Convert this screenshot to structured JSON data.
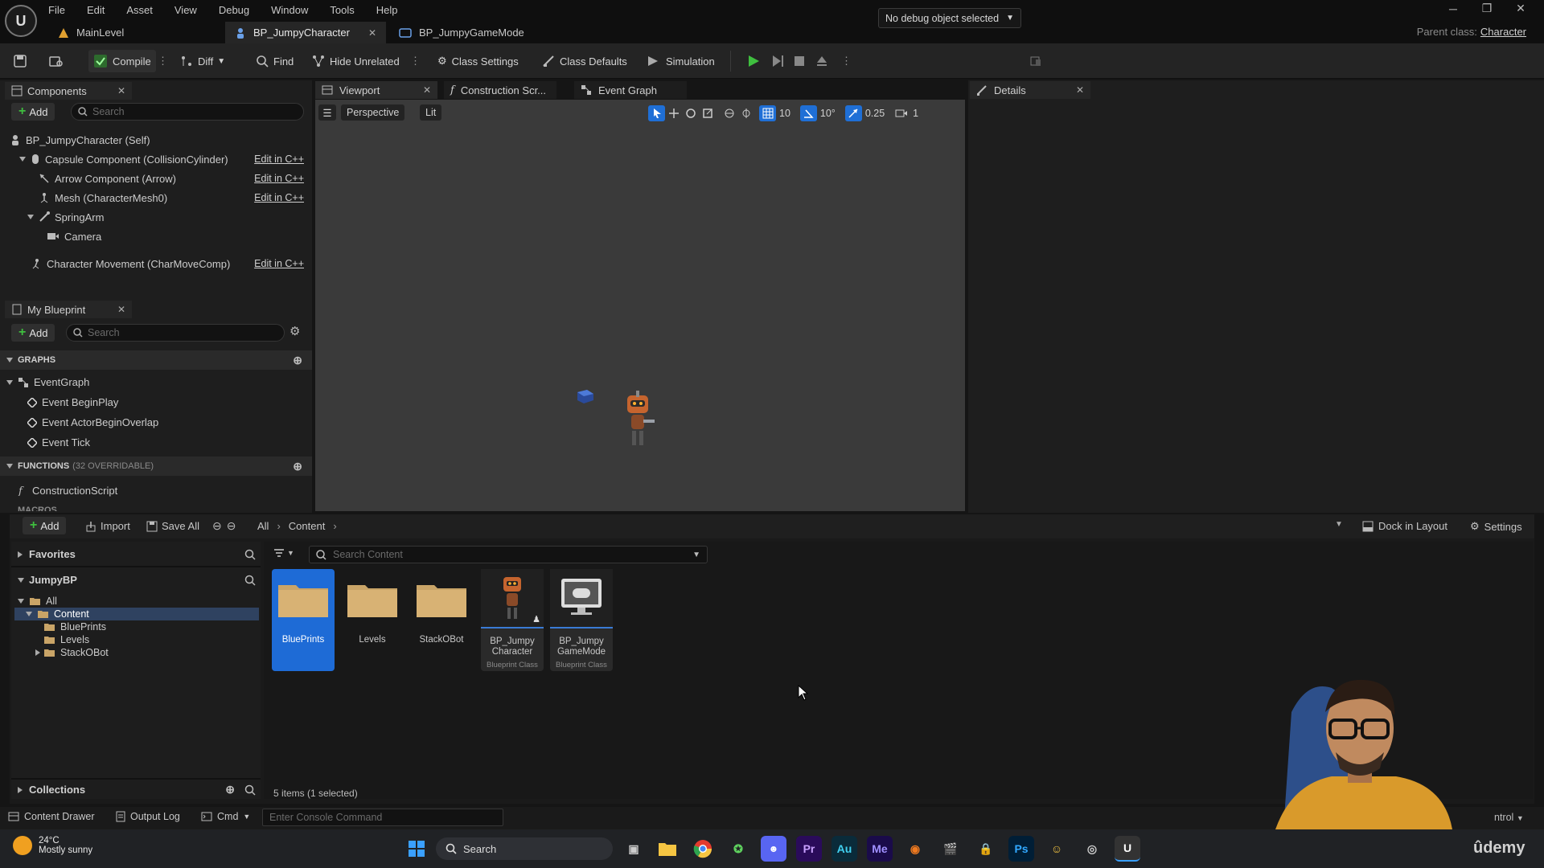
{
  "menu": [
    "File",
    "Edit",
    "Asset",
    "View",
    "Debug",
    "Window",
    "Tools",
    "Help"
  ],
  "doc_tabs": [
    {
      "label": "MainLevel"
    },
    {
      "label": "BP_JumpyCharacter"
    },
    {
      "label": "BP_JumpyGameMode"
    }
  ],
  "parent_class": {
    "label": "Parent class:",
    "value": "Character"
  },
  "toolbar": {
    "compile": "Compile",
    "diff": "Diff",
    "find": "Find",
    "hide_unrelated": "Hide Unrelated",
    "class_settings": "Class Settings",
    "class_defaults": "Class Defaults",
    "simulation": "Simulation",
    "debug_object": "No debug object selected"
  },
  "components": {
    "tab": "Components",
    "add": "Add",
    "search_placeholder": "Search",
    "items": [
      {
        "label": "BP_JumpyCharacter (Self)",
        "edit": ""
      },
      {
        "label": "Capsule Component (CollisionCylinder)",
        "edit": "Edit in C++"
      },
      {
        "label": "Arrow Component (Arrow)",
        "edit": "Edit in C++"
      },
      {
        "label": "Mesh (CharacterMesh0)",
        "edit": "Edit in C++"
      },
      {
        "label": "SpringArm",
        "edit": ""
      },
      {
        "label": "Camera",
        "edit": ""
      },
      {
        "label": "Character Movement (CharMoveComp)",
        "edit": "Edit in C++"
      }
    ]
  },
  "my_blueprint": {
    "tab": "My Blueprint",
    "add": "Add",
    "search_placeholder": "Search",
    "graphs_header": "GRAPHS",
    "graphs": [
      "EventGraph",
      "Event BeginPlay",
      "Event ActorBeginOverlap",
      "Event Tick"
    ],
    "functions_header": "FUNCTIONS",
    "functions_sub": "(32 OVERRIDABLE)",
    "functions": [
      "ConstructionScript"
    ],
    "macros_header": "MACROS"
  },
  "editor_tabs": [
    "Viewport",
    "Construction Scr...",
    "Event Graph"
  ],
  "details_tab": "Details",
  "viewport": {
    "perspective": "Perspective",
    "lit": "Lit",
    "grid": "10",
    "angle": "10°",
    "scale": "0.25",
    "camera_speed": "1"
  },
  "drawer": {
    "add": "Add",
    "import": "Import",
    "save_all": "Save All",
    "path": [
      "All",
      "Content"
    ],
    "dock": "Dock in Layout",
    "settings": "Settings",
    "favorites": "Favorites",
    "project": "JumpyBP",
    "tree": [
      "All",
      "Content",
      "BluePrints",
      "Levels",
      "StackOBot"
    ],
    "collections": "Collections",
    "search_placeholder": "Search Content",
    "status": "5 items (1 selected)",
    "assets": [
      {
        "name": "BluePrints",
        "type": ""
      },
      {
        "name": "Levels",
        "type": ""
      },
      {
        "name": "StackOBot",
        "type": ""
      },
      {
        "name": "BP_Jumpy Character",
        "type": "Blueprint Class"
      },
      {
        "name": "BP_Jumpy GameMode",
        "type": "Blueprint Class"
      }
    ]
  },
  "status_bar": {
    "content_drawer": "Content Drawer",
    "output_log": "Output Log",
    "cmd": "Cmd",
    "console_placeholder": "Enter Console Command",
    "control": "ntrol"
  },
  "taskbar": {
    "temp": "24°C",
    "weather": "Mostly sunny",
    "search": "Search",
    "watermark": "ûdemy"
  },
  "colors": {
    "accent": "#1f6fd6",
    "selected_asset": "#1e6bd6",
    "play": "#3fbf3f",
    "folder": "#c9a467"
  }
}
